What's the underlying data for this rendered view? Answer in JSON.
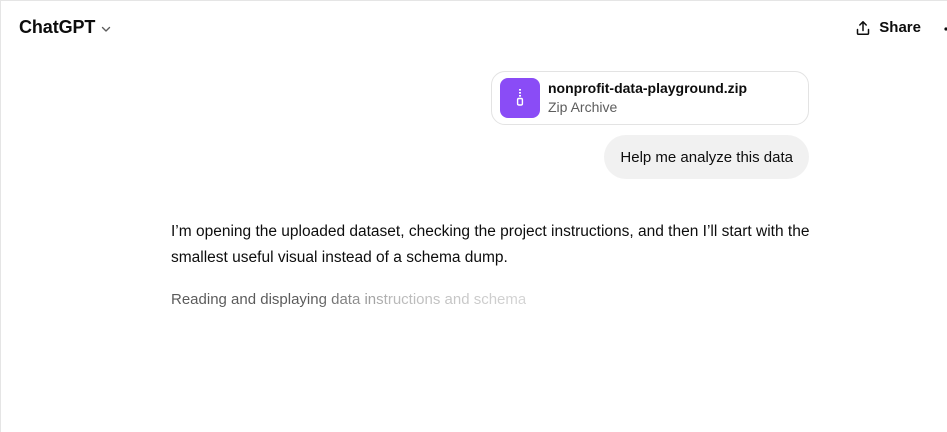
{
  "header": {
    "model_name": "ChatGPT",
    "model_chevron_icon": "chevron-down-icon",
    "share_icon": "share-icon",
    "share_label": "Share",
    "more_icon": "more-options-icon"
  },
  "conversation": {
    "attachment": {
      "icon": "zip-file-icon",
      "icon_color": "#8a4cf6",
      "file_name": "nonprofit-data-playground.zip",
      "file_type": "Zip Archive"
    },
    "user_message": "Help me analyze this data",
    "assistant_message": "I’m opening the uploaded dataset, checking the project instructions, and then I’ll start with the smallest useful visual instead of a schema dump.",
    "status_text": "Reading and displaying data instructions and schema"
  },
  "colors": {
    "bubble_background": "#f1f1f1",
    "text_primary": "#0d0d0d",
    "text_secondary": "#5d5d5d"
  }
}
